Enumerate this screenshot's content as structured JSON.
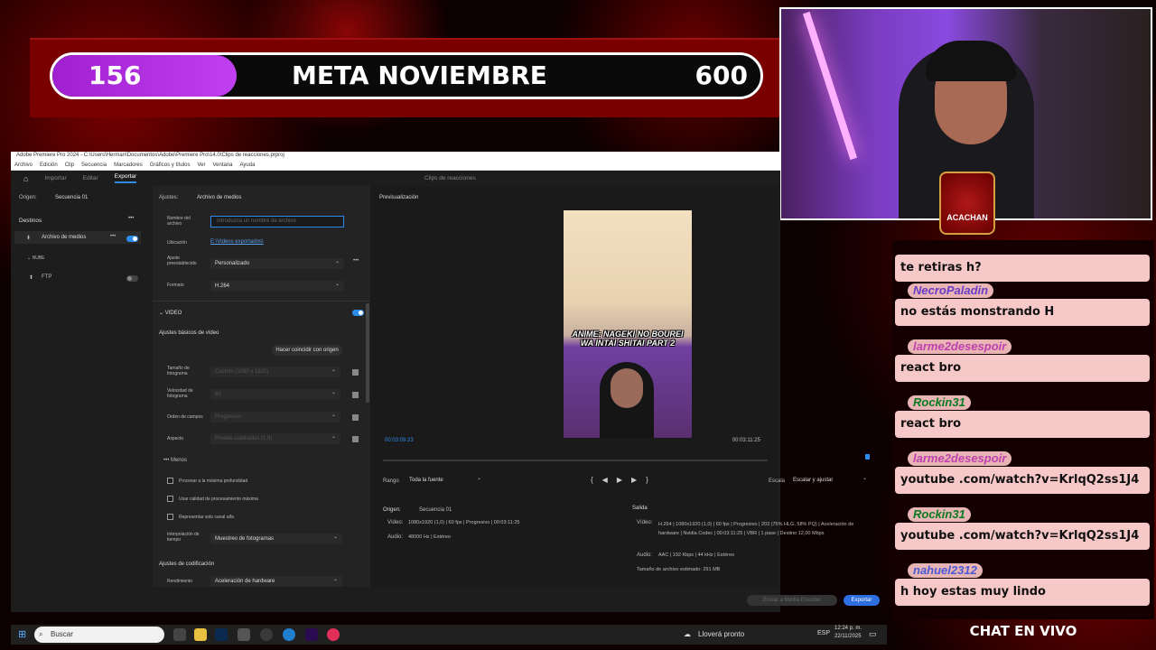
{
  "goal": {
    "current": "156",
    "title": "META NOVIEMBRE",
    "target": "600",
    "progress": 0.26
  },
  "badge": {
    "text": "ACACHAN"
  },
  "premiere": {
    "title": "Adobe Premiere Pro 2024 - C:\\Users\\Herman\\Documentos\\Adobe\\Premiere Pro\\14.0\\Clips de reacciones.prproj",
    "menu": [
      "Archivo",
      "Edición",
      "Clip",
      "Secuencia",
      "Marcadores",
      "Gráficos y títulos",
      "Ver",
      "Ventana",
      "Ayuda"
    ],
    "tabs": {
      "import": "Importar",
      "edit": "Editar",
      "export": "Exportar",
      "project": "Clips de reacciones"
    },
    "origin_label": "Origen:",
    "origin_value": "Secuencia 01",
    "destinations_label": "Destinos",
    "media_file": "Archivo de medios",
    "cloud": "NUBE",
    "ftp": "FTP",
    "settings_label": "Ajustes:",
    "settings_value": "Archivo de medios",
    "filename_label": "Nombre del archivo",
    "filename_placeholder": "Introduzca un nombre de archivo",
    "location_label": "Ubicación",
    "location_value": "E:\\Videos exportados\\",
    "preset_label": "Ajuste preestablecido",
    "preset_value": "Personalizado",
    "format_label": "Formato",
    "format_value": "H.264",
    "video_section": "VIDEO",
    "basic_video": "Ajustes básicos de vídeo",
    "match_source": "Hacer coincidir con origen",
    "frame_size_label": "Tamaño de fotograma",
    "frame_size_value": "Custom (1080 x 1920)",
    "frame_rate_label": "Velocidad de fotograma",
    "frame_rate_value": "60",
    "field_order_label": "Orden de campos",
    "field_order_value": "Progresivo",
    "aspect_label": "Aspecto",
    "aspect_value": "Píxeles cuadrados (1,0)",
    "less": "Menos",
    "opt1": "Procesar a la máxima profundidad",
    "opt2": "Usar calidad de procesamiento máxima",
    "opt3": "Representar solo canal alfa",
    "interp_label": "Interpolación de tiempo",
    "interp_value": "Muestreo de fotogramas",
    "encoding_label": "Ajustes de codificación",
    "performance_label": "Rendimiento",
    "performance_value": "Aceleración de hardware",
    "preview_label": "Previsualización",
    "preview_caption": "ANIME: NAGEKI NO BOUREI WA INTAI SHITAI PART 2",
    "timecode_current": "00:03:09:23",
    "timecode_end": "00:03:11:25",
    "range_label": "Rango",
    "range_value": "Toda la fuente",
    "scale_label": "Escala",
    "scale_value": "Escalar y ajustar",
    "source_label": "Origen:",
    "source_value": "Secuencia 01",
    "src_video_label": "Vídeo:",
    "src_video_value": "1080x1920 (1,0)  |  60 fps  |  Progresivo  |  00:03:11:25",
    "src_audio_label": "Audio:",
    "src_audio_value": "48000 Hz  |  Estéreo",
    "output_label": "Salida",
    "out_video_label": "Vídeo:",
    "out_video_value": "H.264  |  1080x1920 (1,0)  |  60 fps  |  Progresivo  |  203 (75% HLG, 58% PQ)  |  Aceleración de hardware  |  Nvidia Codec  |  00:03:11:25  |  VBR  |  1 pase  |  Destino 12,00 Mbps",
    "out_audio_label": "Audio:",
    "out_audio_value": "AAC  |  192 Kbps  |  44 kHz  |  Estéreo",
    "est_size": "Tamaño de archivo estimado:  291 MB",
    "send_encoder": "Enviar a Media Encoder",
    "export_button": "Exportar"
  },
  "chat": {
    "messages": [
      {
        "name": "",
        "text": "te retiras h?",
        "color": "#000000"
      },
      {
        "name": "NecroPaladin",
        "text": "no estás monstrando H",
        "color": "#6a3cc8"
      },
      {
        "name": "larme2desespoir",
        "text": "react bro",
        "color": "#c040b0"
      },
      {
        "name": "Rockin31",
        "text": "react bro",
        "color": "#0a7a20"
      },
      {
        "name": "larme2desespoir",
        "text": "youtube .com/watch?v=KrlqQ2ss1J4",
        "color": "#c040b0"
      },
      {
        "name": "Rockin31",
        "text": "youtube .com/watch?v=KrlqQ2ss1J4",
        "color": "#0a7a20"
      },
      {
        "name": "nahuel2312",
        "text": "h hoy estas muy lindo",
        "color": "#4a5ad8"
      }
    ],
    "footer": "CHAT EN VIVO"
  },
  "taskbar": {
    "search": "Buscar",
    "weather": "Lloverá pronto",
    "lang": "ESP",
    "time": "12:24 p. m.",
    "date": "22/11/2025"
  },
  "colors": {
    "accent": "#2d8ceb",
    "goal_fill": "#b030e0",
    "chat_bubble": "#f7c8c8"
  }
}
